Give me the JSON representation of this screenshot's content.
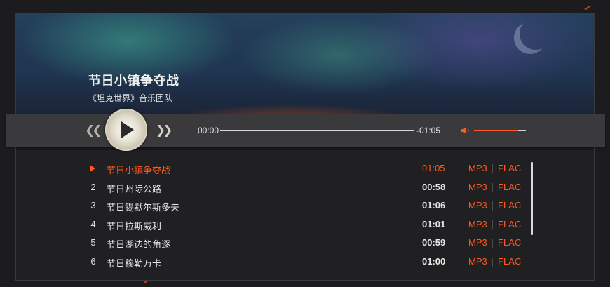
{
  "now_playing": {
    "title": "节日小镇争夺战",
    "artist": "《坦克世界》音乐团队"
  },
  "player": {
    "current_time": "00:00",
    "remaining_time": "-01:05",
    "progress": 0.0,
    "volume": 0.85,
    "icons": {
      "prev": "rewind-icon",
      "play": "play-icon",
      "next": "fast-forward-icon",
      "volume": "volume-icon"
    }
  },
  "playlist": [
    {
      "index": "",
      "title": "节日小镇争夺战",
      "duration": "01:05",
      "formats": [
        "MP3",
        "FLAC"
      ],
      "active": true
    },
    {
      "index": "2",
      "title": "节日州际公路",
      "duration": "00:58",
      "formats": [
        "MP3",
        "FLAC"
      ],
      "active": false
    },
    {
      "index": "3",
      "title": "节日锡默尔斯多夫",
      "duration": "01:06",
      "formats": [
        "MP3",
        "FLAC"
      ],
      "active": false
    },
    {
      "index": "4",
      "title": "节日拉斯威利",
      "duration": "01:01",
      "formats": [
        "MP3",
        "FLAC"
      ],
      "active": false
    },
    {
      "index": "5",
      "title": "节日湖边的角逐",
      "duration": "00:59",
      "formats": [
        "MP3",
        "FLAC"
      ],
      "active": false
    },
    {
      "index": "6",
      "title": "节日穆勒万卡",
      "duration": "01:00",
      "formats": [
        "MP3",
        "FLAC"
      ],
      "active": false
    }
  ],
  "colors": {
    "accent": "#ff5a1f",
    "background": "#1c1b1d",
    "bar": "#3a3a3c"
  }
}
